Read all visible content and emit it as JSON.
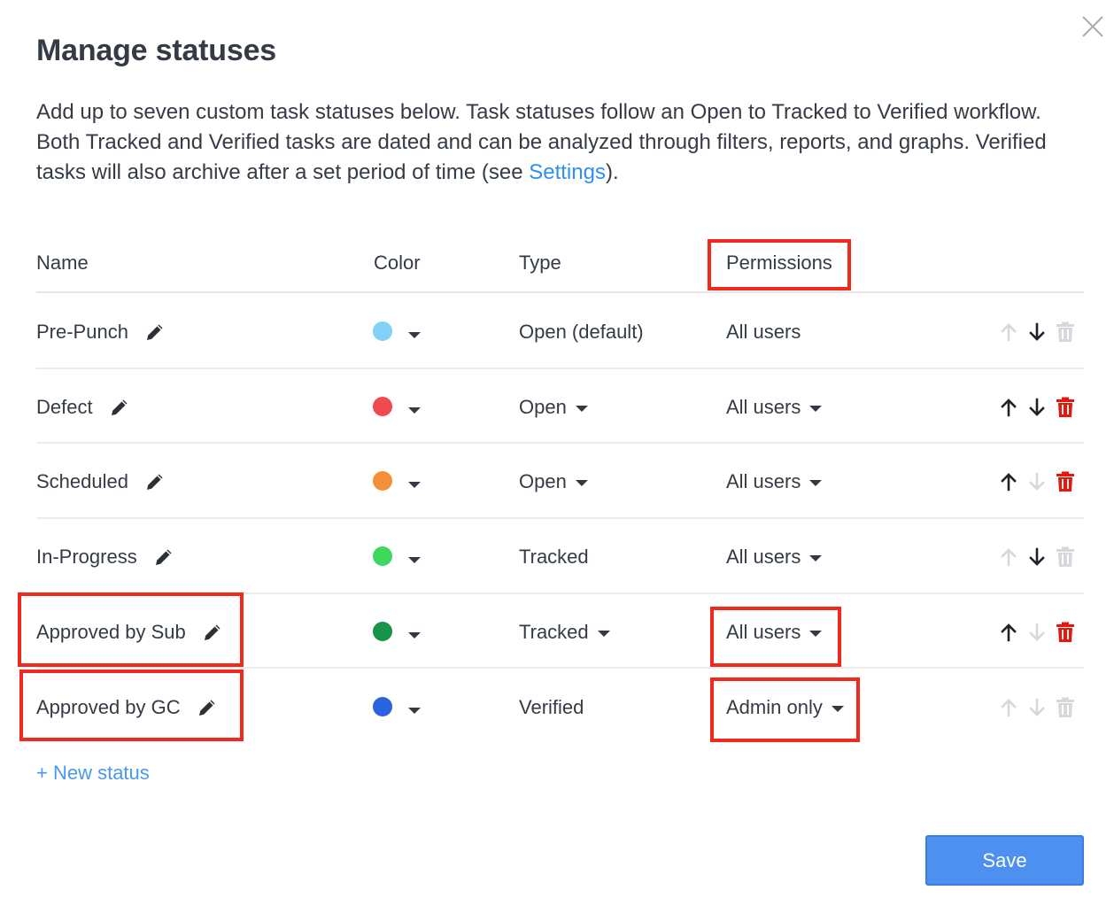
{
  "dialog": {
    "title": "Manage statuses",
    "description_before": "Add up to seven custom task statuses below. Task statuses follow an Open to Tracked to Verified workflow. Both Tracked and Verified tasks are dated and can be analyzed through filters, reports, and graphs. Verified tasks will also archive after a set period of time (see ",
    "settings_link": "Settings",
    "description_after": ").",
    "close_icon": "close-icon"
  },
  "table": {
    "headers": {
      "name": "Name",
      "color": "Color",
      "type": "Type",
      "permissions": "Permissions"
    },
    "rows": [
      {
        "name": "Pre-Punch",
        "color": "#7fd1f7",
        "type": "Open (default)",
        "type_dropdown": false,
        "permission": "All users",
        "permission_dropdown": false,
        "up_enabled": false,
        "down_enabled": true,
        "delete_enabled": false
      },
      {
        "name": "Defect",
        "color": "#f04a4f",
        "type": "Open",
        "type_dropdown": true,
        "permission": "All users",
        "permission_dropdown": true,
        "up_enabled": true,
        "down_enabled": true,
        "delete_enabled": true
      },
      {
        "name": "Scheduled",
        "color": "#f58f38",
        "type": "Open",
        "type_dropdown": true,
        "permission": "All users",
        "permission_dropdown": true,
        "up_enabled": true,
        "down_enabled": false,
        "delete_enabled": true
      },
      {
        "name": "In-Progress",
        "color": "#3ed85e",
        "type": "Tracked",
        "type_dropdown": false,
        "permission": "All users",
        "permission_dropdown": true,
        "up_enabled": false,
        "down_enabled": true,
        "delete_enabled": false
      },
      {
        "name": "Approved by Sub",
        "color": "#17934a",
        "type": "Tracked",
        "type_dropdown": true,
        "permission": "All users",
        "permission_dropdown": true,
        "up_enabled": true,
        "down_enabled": false,
        "delete_enabled": true
      },
      {
        "name": "Approved by GC",
        "color": "#2b62e0",
        "type": "Verified",
        "type_dropdown": false,
        "permission": "Admin only",
        "permission_dropdown": true,
        "up_enabled": false,
        "down_enabled": false,
        "delete_enabled": false
      }
    ]
  },
  "actions": {
    "new_status": "+ New status",
    "save": "Save"
  },
  "colors": {
    "enabled_arrow": "#1f2329",
    "disabled_arrow": "#d6d8db",
    "delete_active": "#e8160c",
    "delete_inactive": "#d6d8db",
    "highlight": "#f0281e",
    "link": "#2d8ff0"
  }
}
